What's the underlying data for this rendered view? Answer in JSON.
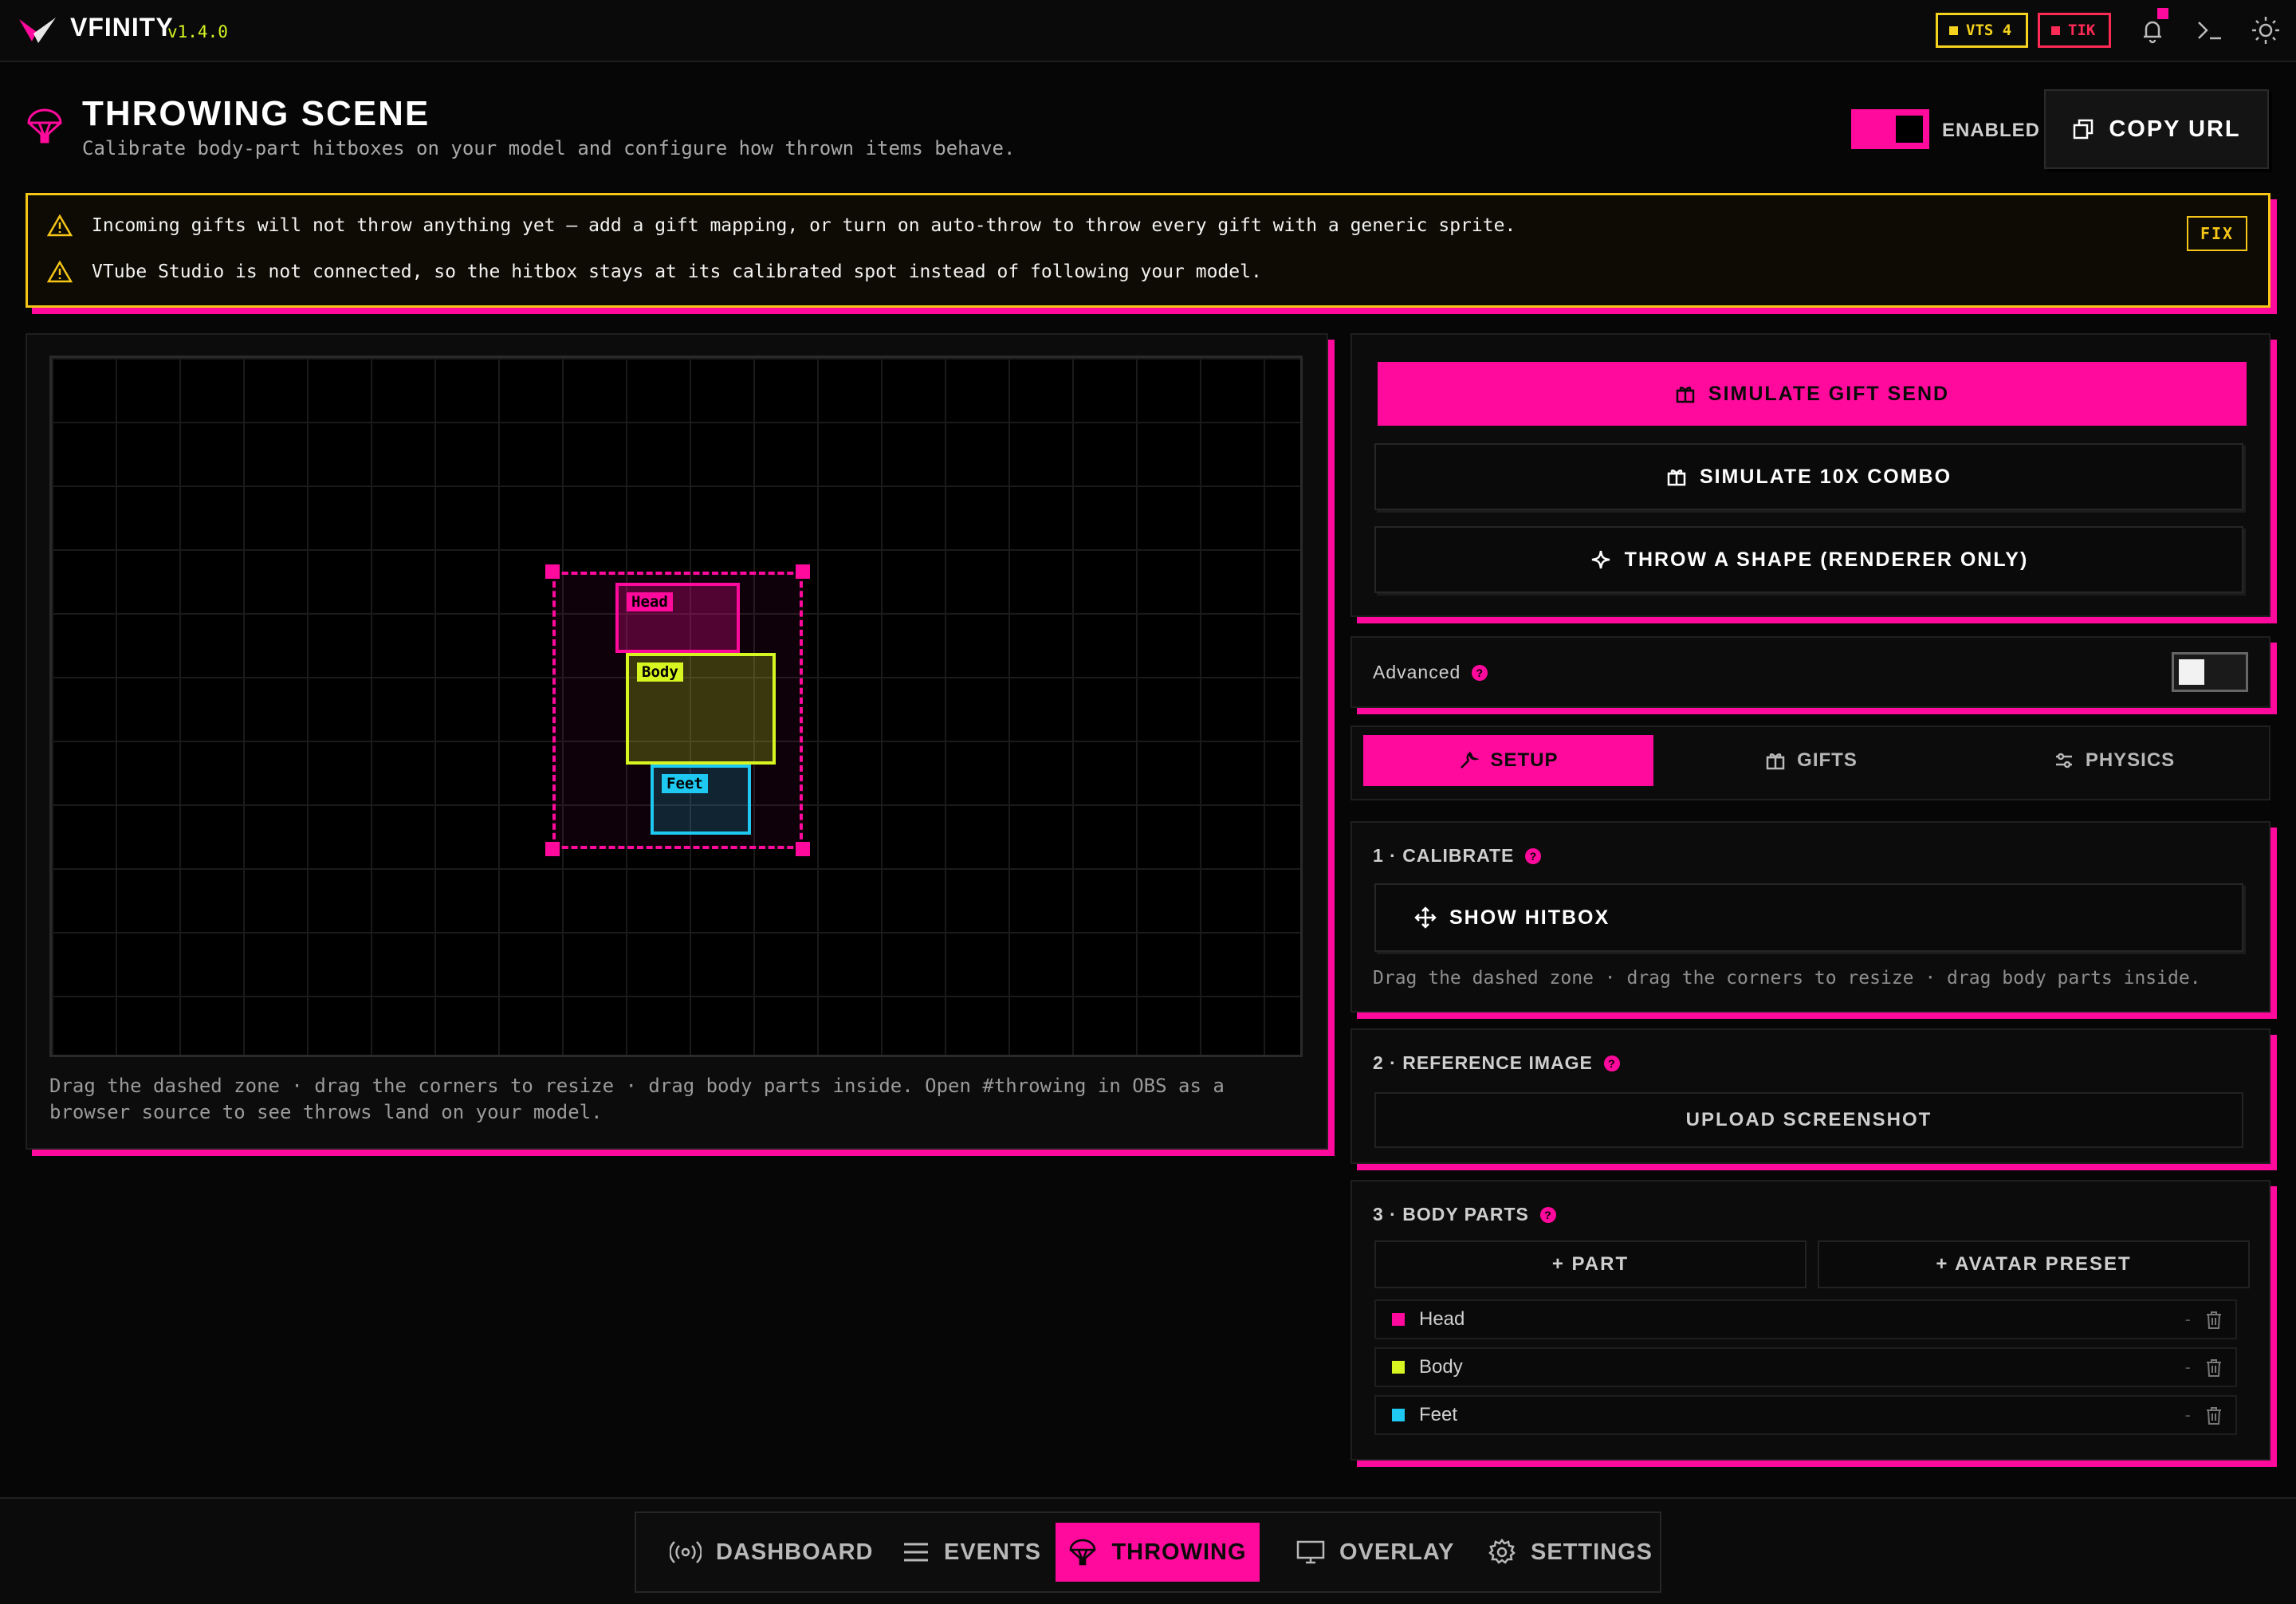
{
  "app": {
    "brand": "VFINITY",
    "version": "v1.4.0",
    "badges": {
      "vts": "VTS 4",
      "tik": "TIK"
    },
    "icons": [
      "bell-icon",
      "terminal-icon",
      "sun-icon"
    ],
    "colors": {
      "accent": "#ff0a9c",
      "lime": "#d7f521",
      "yellow": "#f5c518",
      "cyan": "#1ec8f0",
      "red": "#ff2a55"
    }
  },
  "header": {
    "title": "THROWING SCENE",
    "subtitle": "Calibrate body-part hitboxes on your model and configure how thrown items behave.",
    "enabled_label": "ENABLED",
    "enabled": true,
    "copy_url_label": "COPY URL"
  },
  "warnings": {
    "lines": [
      "Incoming gifts will not throw anything yet — add a gift mapping, or turn on auto-throw to throw every gift with a generic sprite.",
      "VTube Studio is not connected, so the hitbox stays at its calibrated spot instead of following your model."
    ],
    "fix_label": "FIX"
  },
  "canvas": {
    "parts": [
      {
        "label": "Head",
        "color": "#ff0a9c"
      },
      {
        "label": "Body",
        "color": "#d7f521"
      },
      {
        "label": "Feet",
        "color": "#1ec8f0"
      }
    ],
    "help_text": "Drag the dashed zone · drag the corners to resize · drag body parts inside. Open #throwing in OBS as a browser source to see throws land on your model."
  },
  "actions": {
    "simulate_gift": "SIMULATE GIFT SEND",
    "simulate_combo": "SIMULATE 10X COMBO",
    "throw_shape": "THROW A SHAPE (RENDERER ONLY)"
  },
  "advanced": {
    "label": "Advanced",
    "enabled": false
  },
  "tabs": [
    {
      "label": "SETUP",
      "active": true,
      "icon": "wrench-icon"
    },
    {
      "label": "GIFTS",
      "active": false,
      "icon": "gift-icon"
    },
    {
      "label": "PHYSICS",
      "active": false,
      "icon": "sliders-icon"
    }
  ],
  "calibrate": {
    "title": "1 · CALIBRATE",
    "button": "SHOW HITBOX",
    "help": "Drag the dashed zone · drag the corners to resize · drag body parts inside."
  },
  "reference": {
    "title": "2 · REFERENCE IMAGE",
    "button": "UPLOAD SCREENSHOT"
  },
  "body_parts": {
    "title": "3 · BODY PARTS",
    "add_part": "+ PART",
    "avatar_preset": "+ AVATAR PRESET",
    "items": [
      {
        "label": "Head",
        "color": "#ff0a9c",
        "value": "-"
      },
      {
        "label": "Body",
        "color": "#d7f521",
        "value": "-"
      },
      {
        "label": "Feet",
        "color": "#1ec8f0",
        "value": "-"
      }
    ]
  },
  "nav": [
    {
      "label": "DASHBOARD",
      "icon": "broadcast-icon",
      "active": false
    },
    {
      "label": "EVENTS",
      "icon": "list-icon",
      "active": false
    },
    {
      "label": "THROWING",
      "icon": "parachute-icon",
      "active": true
    },
    {
      "label": "OVERLAY",
      "icon": "monitor-icon",
      "active": false
    },
    {
      "label": "SETTINGS",
      "icon": "gear-icon",
      "active": false
    }
  ]
}
